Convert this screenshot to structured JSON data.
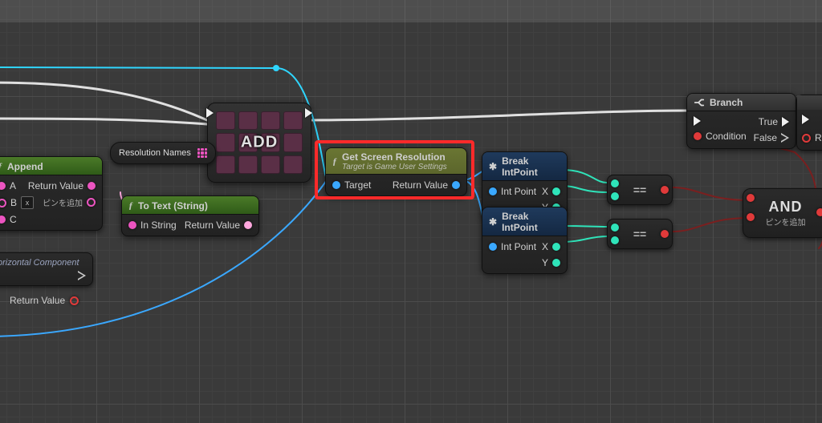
{
  "macro": {
    "add_label": "ADD"
  },
  "var": {
    "resolution_names": "Resolution Names"
  },
  "horizontal_component": {
    "label": "orizontal Component",
    "return_value": "Return Value"
  },
  "append": {
    "title": "Append",
    "pin_a": "A",
    "pin_b": "B",
    "pin_c": "C",
    "b_default": "x",
    "return_value": "Return Value",
    "add_pin": "ピンを追加"
  },
  "to_text": {
    "title": "To Text (String)",
    "in": "In String",
    "out": "Return Value"
  },
  "get_screen_resolution": {
    "title": "Get Screen Resolution",
    "subtitle": "Target is Game User Settings",
    "target": "Target",
    "return_value": "Return Value"
  },
  "break1": {
    "title": "Break IntPoint",
    "in": "Int Point",
    "x": "X",
    "y": "Y"
  },
  "break2": {
    "title": "Break IntPoint",
    "in": "Int Point",
    "x": "X",
    "y": "Y"
  },
  "cmp": {
    "eq": "=="
  },
  "and": {
    "title": "AND",
    "add_pin": "ピンを追加"
  },
  "branch": {
    "title": "Branch",
    "condition": "Condition",
    "true": "True",
    "false": "False"
  },
  "edge": {
    "re": "Re"
  }
}
